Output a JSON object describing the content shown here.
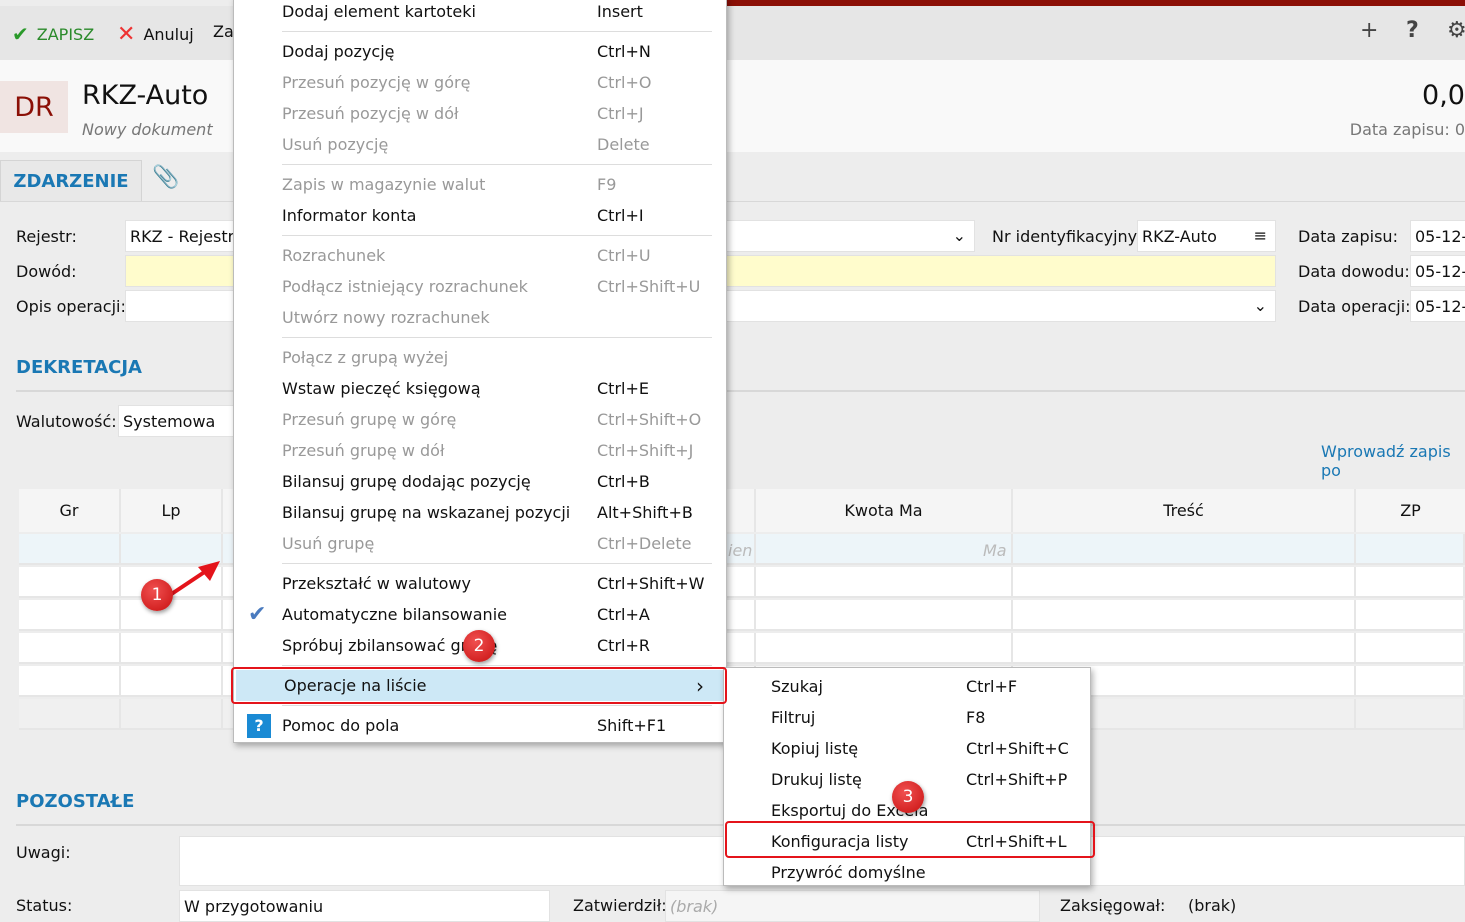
{
  "toolbar": {
    "save": "ZAPISZ",
    "cancel": "Anuluj",
    "third": "Za"
  },
  "header": {
    "badge": "DR",
    "title": "RKZ-Auto",
    "subtitle": "Nowy dokument",
    "amount": "0,0",
    "date_label": "Data zapisu: 0"
  },
  "tabs": {
    "event": "ZDARZENIE"
  },
  "form": {
    "rejestr_label": "Rejestr:",
    "rejestr_value": "RKZ - Rejestr z",
    "dowod_label": "Dowód:",
    "opis_label": "Opis operacji:",
    "nr_label": "Nr identyfikacyjny:",
    "nr_value": "RKZ-Auto",
    "data_zapisu_label": "Data zapisu:",
    "data_dowodu_label": "Data dowodu:",
    "data_operacji_label": "Data operacji:",
    "date_value": "05-12-"
  },
  "dekretacja": {
    "title": "DEKRETACJA",
    "walutowosc_label": "Walutowość:",
    "walutowosc_value": "Systemowa",
    "link": "Wprowadź zapis po"
  },
  "grid": {
    "headers": [
      "Gr",
      "Lp",
      "Kwota Ma",
      "Treść",
      "ZP"
    ],
    "placeholders": [
      "ien",
      "Ma"
    ]
  },
  "pozostale": {
    "title": "POZOSTAŁE",
    "uwagi_label": "Uwagi:",
    "status_label": "Status:",
    "status_value": "W przygotowaniu",
    "zatwierdzil_label": "Zatwierdził:",
    "zatwierdzil_value": "(brak)",
    "zaksiegowal_label": "Zaksięgował:",
    "zaksiegowal_value": "(brak)"
  },
  "menu": [
    {
      "label": "Dodaj element kartoteki",
      "shortcut": "Insert"
    },
    {
      "sep": true
    },
    {
      "label": "Dodaj pozycję",
      "shortcut": "Ctrl+N"
    },
    {
      "label": "Przesuń pozycję w górę",
      "shortcut": "Ctrl+O",
      "disabled": true
    },
    {
      "label": "Przesuń pozycję w dół",
      "shortcut": "Ctrl+J",
      "disabled": true
    },
    {
      "label": "Usuń pozycję",
      "shortcut": "Delete",
      "disabled": true
    },
    {
      "sep": true
    },
    {
      "label": "Zapis w magazynie walut",
      "shortcut": "F9",
      "disabled": true
    },
    {
      "label": "Informator konta",
      "shortcut": "Ctrl+I"
    },
    {
      "sep": true
    },
    {
      "label": "Rozrachunek",
      "shortcut": "Ctrl+U",
      "disabled": true
    },
    {
      "label": "Podłącz istniejący rozrachunek",
      "shortcut": "Ctrl+Shift+U",
      "disabled": true
    },
    {
      "label": "Utwórz nowy rozrachunek",
      "shortcut": "",
      "disabled": true
    },
    {
      "sep": true
    },
    {
      "label": "Połącz z grupą wyżej",
      "shortcut": "",
      "disabled": true
    },
    {
      "label": "Wstaw pieczęć księgową",
      "shortcut": "Ctrl+E"
    },
    {
      "label": "Przesuń grupę w górę",
      "shortcut": "Ctrl+Shift+O",
      "disabled": true
    },
    {
      "label": "Przesuń grupę w dół",
      "shortcut": "Ctrl+Shift+J",
      "disabled": true
    },
    {
      "label": "Bilansuj grupę dodając pozycję",
      "shortcut": "Ctrl+B"
    },
    {
      "label": "Bilansuj grupę na wskazanej pozycji",
      "shortcut": "Alt+Shift+B"
    },
    {
      "label": "Usuń grupę",
      "shortcut": "Ctrl+Delete",
      "disabled": true
    },
    {
      "sep": true
    },
    {
      "label": "Przekształć w walutowy",
      "shortcut": "Ctrl+Shift+W"
    },
    {
      "label": "Automatyczne bilansowanie",
      "shortcut": "Ctrl+A",
      "checked": true
    },
    {
      "label": "Spróbuj zbilansować grupę",
      "shortcut": "Ctrl+R"
    },
    {
      "sep": true
    },
    {
      "label": "Operacje na liście",
      "shortcut": "›",
      "highlighted": true
    },
    {
      "sep": true
    },
    {
      "label": "Pomoc do pola",
      "shortcut": "Shift+F1",
      "help": true
    }
  ],
  "submenu": [
    {
      "label": "Szukaj",
      "shortcut": "Ctrl+F"
    },
    {
      "label": "Filtruj",
      "shortcut": "F8"
    },
    {
      "label": "Kopiuj listę",
      "shortcut": "Ctrl+Shift+C"
    },
    {
      "label": "Drukuj listę",
      "shortcut": "Ctrl+Shift+P"
    },
    {
      "label": "Eksportuj do Excela",
      "shortcut": ""
    },
    {
      "label": "Konfiguracja listy",
      "shortcut": "Ctrl+Shift+L"
    },
    {
      "label": "Przywróć domyślne",
      "shortcut": ""
    }
  ],
  "annotations": [
    "1",
    "2",
    "3"
  ]
}
